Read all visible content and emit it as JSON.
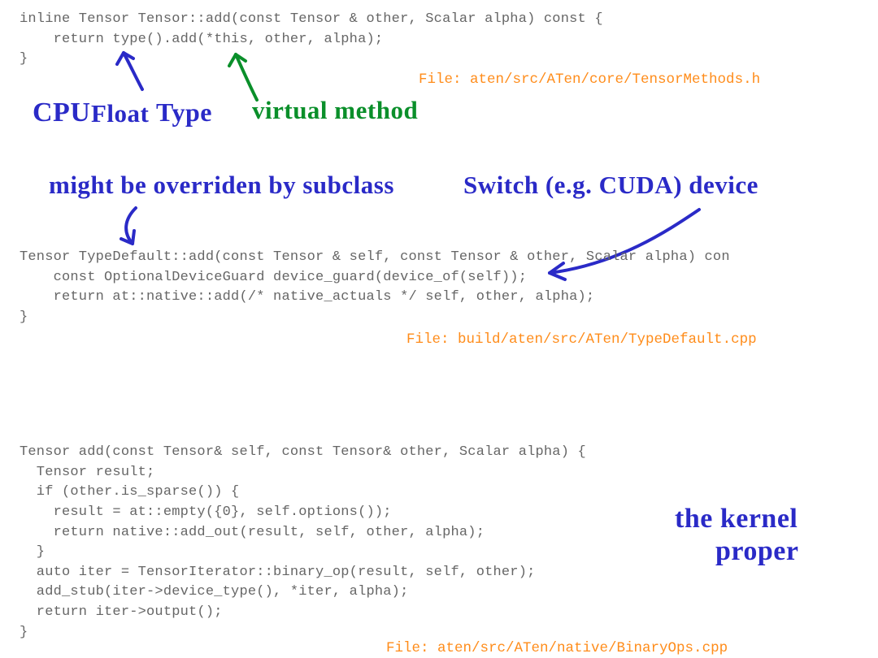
{
  "code": {
    "block1": "inline Tensor Tensor::add(const Tensor & other, Scalar alpha) const {\n    return type().add(*this, other, alpha);\n}",
    "block2": "Tensor TypeDefault::add(const Tensor & self, const Tensor & other, Scalar alpha) con\n    const OptionalDeviceGuard device_guard(device_of(self));\n    return at::native::add(/* native_actuals */ self, other, alpha);\n}",
    "block3": "Tensor add(const Tensor& self, const Tensor& other, Scalar alpha) {\n  Tensor result;\n  if (other.is_sparse()) {\n    result = at::empty({0}, self.options());\n    return native::add_out(result, self, other, alpha);\n  }\n  auto iter = TensorIterator::binary_op(result, self, other);\n  add_stub(iter->device_type(), *iter, alpha);\n  return iter->output();\n}"
  },
  "files": {
    "f1": "File: aten/src/ATen/core/TensorMethods.h",
    "f2": "File: build/aten/src/ATen/TypeDefault.cpp",
    "f3": "File: aten/src/ATen/native/BinaryOps.cpp"
  },
  "annotations": {
    "cpufloat_cpu": "CPU",
    "cpufloat_float": "Float",
    "cpufloat_type": "Type",
    "virtual_method": "virtual method",
    "might_override": "might be overriden by subclass",
    "switch_device": "Switch  (e.g. CUDA)  device",
    "kernel_proper_l1": "the kernel",
    "kernel_proper_l2": "proper"
  }
}
